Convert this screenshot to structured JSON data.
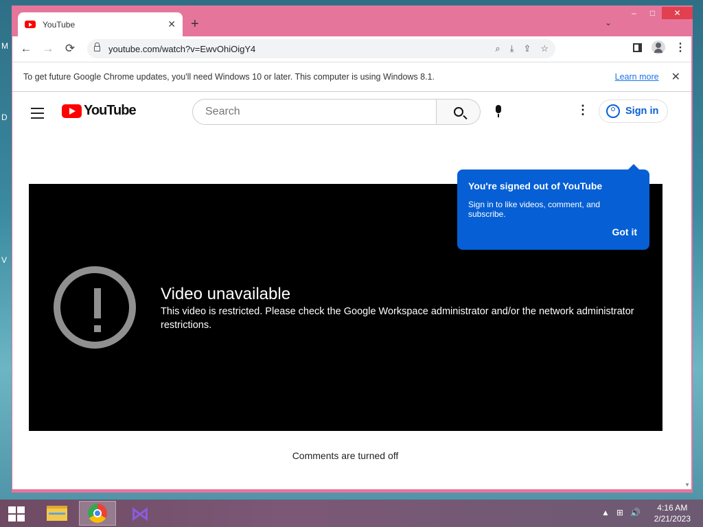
{
  "desktop": {
    "edge_letters": [
      "M",
      "D",
      "V"
    ]
  },
  "window": {
    "controls": {
      "minimize": "–",
      "maximize": "□",
      "close": "✕"
    }
  },
  "tab": {
    "title": "YouTube",
    "close": "✕",
    "new_tab": "+",
    "tab_menu": "⌄"
  },
  "toolbar": {
    "back": "←",
    "forward": "→",
    "reload": "⟳",
    "url": "youtube.com/watch?v=EwvOhiOigY4",
    "menu": "⋮"
  },
  "infobar": {
    "message": "To get future Google Chrome updates, you'll need Windows 10 or later. This computer is using Windows 8.1.",
    "link": "Learn more",
    "close": "✕"
  },
  "youtube": {
    "logo": "YouTube",
    "search_placeholder": "Search",
    "kebab": "⋮",
    "sign_in": "Sign in"
  },
  "tooltip": {
    "title": "You're signed out of YouTube",
    "body": "Sign in to like videos, comment, and subscribe.",
    "button": "Got it"
  },
  "player": {
    "title": "Video unavailable",
    "message": "This video is restricted. Please check the Google Workspace administrator and/or the network administrator restrictions."
  },
  "comments": {
    "status": "Comments are turned off"
  },
  "taskbar": {
    "time": "4:16 AM",
    "date": "2/21/2023",
    "tray": {
      "up": "▲",
      "network": "⊞",
      "volume": "🔊"
    }
  },
  "colors": {
    "accent_blue": "#065fd4",
    "frame_pink": "#e6759b",
    "yt_red": "#ff0000"
  }
}
